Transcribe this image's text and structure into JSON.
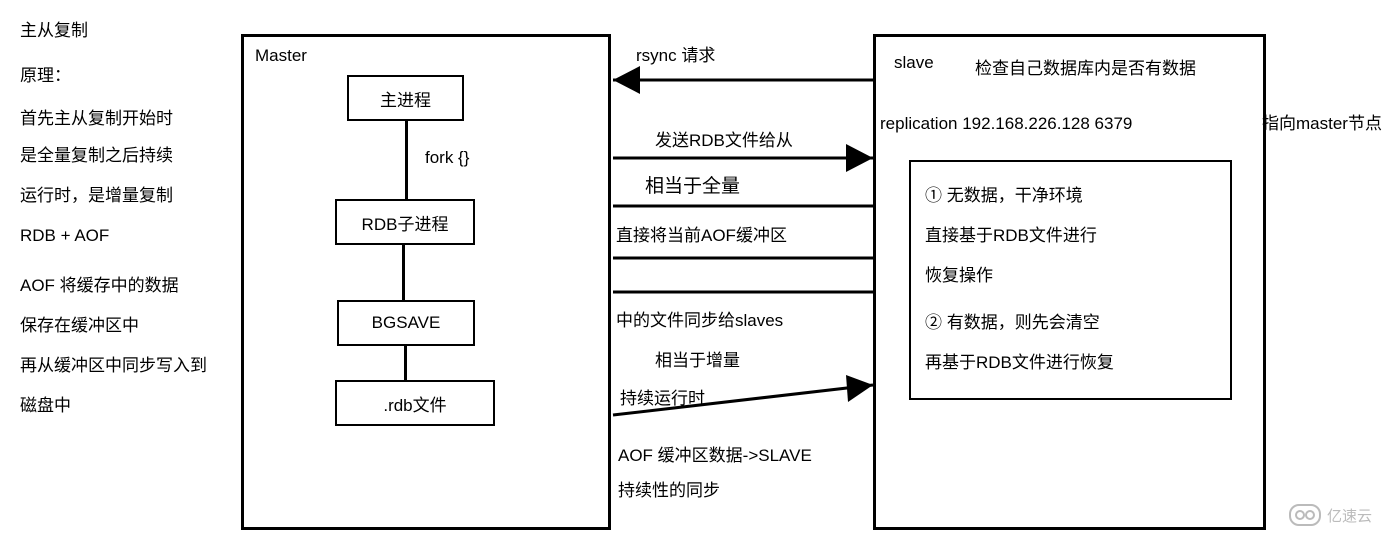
{
  "left": {
    "title": "主从复制",
    "principle": "原理：",
    "p1": "首先主从复制开始时",
    "p2": "是全量复制之后持续",
    "p3": "运行时，是增量复制",
    "p4": "RDB + AOF",
    "p5": "AOF 将缓存中的数据",
    "p6": "保存在缓冲区中",
    "p7": "再从缓冲区中同步写入到",
    "p8": "磁盘中"
  },
  "master": {
    "label": "Master",
    "main_proc": "主进程",
    "fork": "fork {}",
    "rdb_proc": "RDB子进程",
    "bgsave": "BGSAVE",
    "rdb_file": ".rdb文件"
  },
  "mid": {
    "rsync": "rsync 请求",
    "sendrdb": "发送RDB文件给从",
    "full": "相当于全量",
    "aofbuf": "直接将当前AOF缓冲区",
    "syncslaves": "中的文件同步给slaves",
    "inc": "相当于增量",
    "running": "持续运行时",
    "aofslave1": "AOF 缓冲区数据->SLAVE",
    "aofslave2": "持续性的同步"
  },
  "slave": {
    "label": "slave",
    "check": "检查自己数据库内是否有数据",
    "repl": "replication 192.168.226.128 6379",
    "arrow": "指向master节点",
    "b1": "① 无数据，干净环境",
    "b2": "直接基于RDB文件进行",
    "b3": "恢复操作",
    "b4": "② 有数据，则先会清空",
    "b5": "再基于RDB文件进行恢复"
  },
  "watermark": "亿速云"
}
